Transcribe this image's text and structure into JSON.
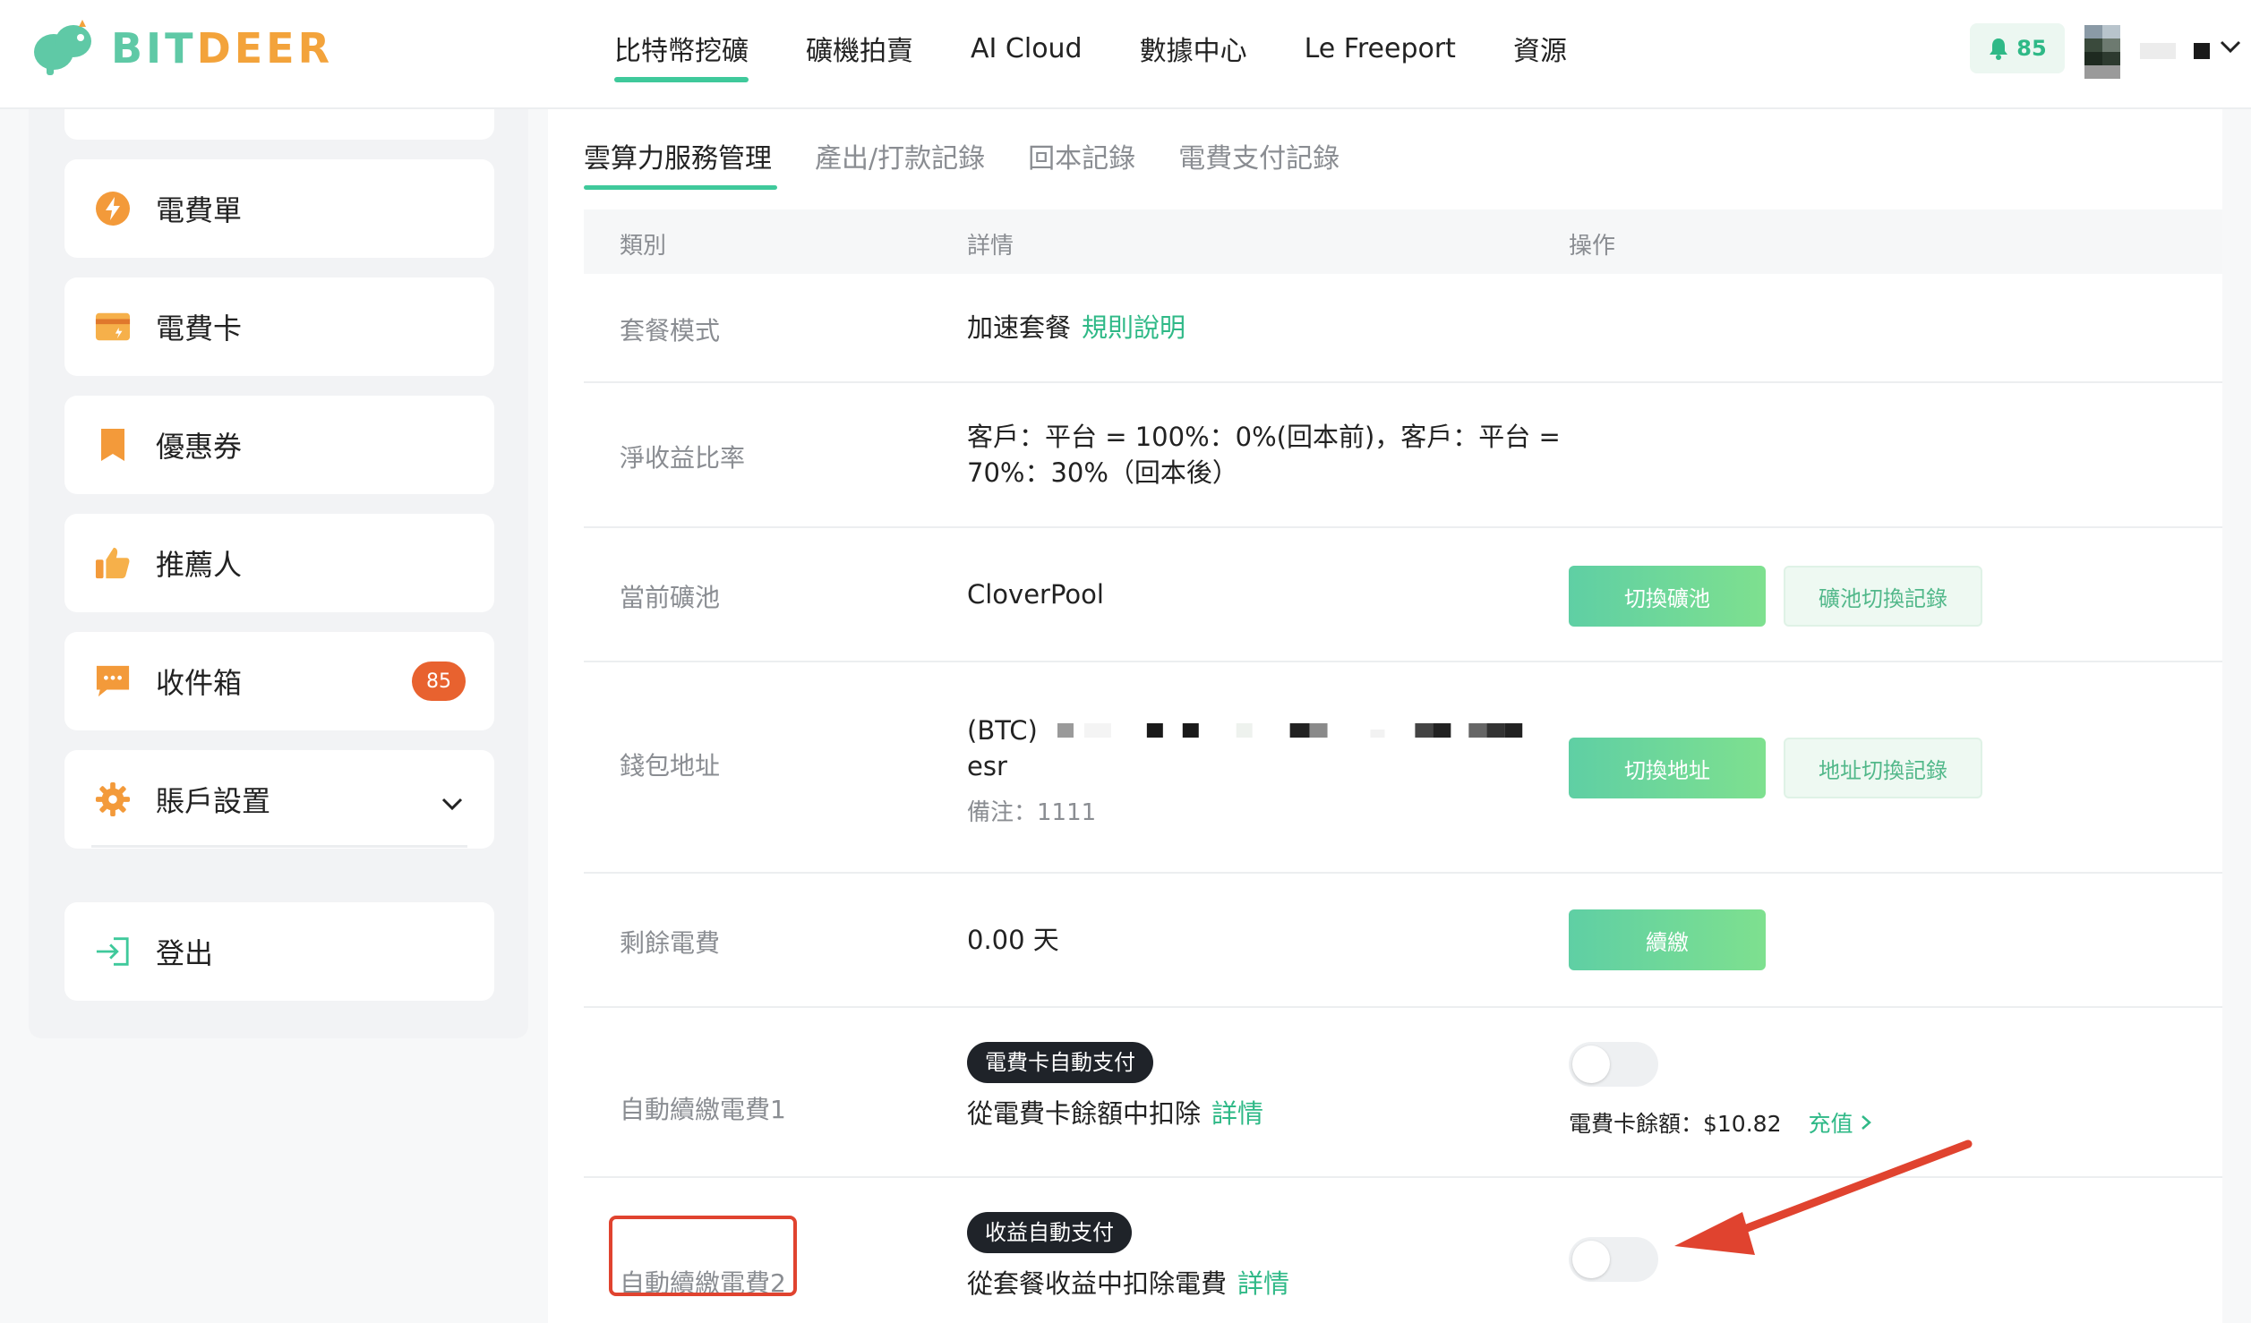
{
  "brand": {
    "name_part1": "BIT",
    "name_part2": "DEER",
    "color_green": "#5fc9a6",
    "color_orange": "#f3a33b"
  },
  "nav": {
    "items": [
      "比特幣挖礦",
      "礦機拍賣",
      "AI Cloud",
      "數據中心",
      "Le Freeport",
      "資源"
    ],
    "active_index": 0
  },
  "header": {
    "notification_count": "85"
  },
  "sidebar": {
    "items": [
      {
        "label": "電費單",
        "icon": "lightning-icon"
      },
      {
        "label": "電費卡",
        "icon": "card-icon"
      },
      {
        "label": "優惠券",
        "icon": "bookmark-icon"
      },
      {
        "label": "推薦人",
        "icon": "thumbs-up-icon"
      },
      {
        "label": "收件箱",
        "icon": "message-icon",
        "badge": "85"
      },
      {
        "label": "賬戶設置",
        "icon": "gear-icon"
      },
      {
        "label": "登出",
        "icon": "logout-icon"
      }
    ]
  },
  "tabs": [
    "雲算力服務管理",
    "產出/打款記錄",
    "回本記錄",
    "電費支付記錄"
  ],
  "table": {
    "headers": {
      "category": "類別",
      "details": "詳情",
      "actions": "操作"
    },
    "rows": {
      "plan": {
        "category": "套餐模式",
        "value": "加速套餐",
        "link": "規則說明"
      },
      "ratio": {
        "category": "淨收益比率",
        "line1": "客戶：平台 = 100%：0%(回本前)，客戶：平台 =",
        "line2": "70%：30%（回本後）"
      },
      "pool": {
        "category": "當前礦池",
        "value": "CloverPool",
        "btn_primary": "切換礦池",
        "btn_secondary": "礦池切換記錄"
      },
      "wallet": {
        "category": "錢包地址",
        "prefix": "(BTC)",
        "suffix": "esr",
        "note": "備注：1111",
        "btn_primary": "切換地址",
        "btn_secondary": "地址切換記錄"
      },
      "fee": {
        "category": "剩餘電費",
        "value": "0.00 天",
        "btn_primary": "續繳"
      },
      "auto1": {
        "category": "自動續繳電費1",
        "tag": "電費卡自動支付",
        "desc": "從電費卡餘額中扣除",
        "link": "詳情",
        "balance_label": "電費卡餘額：$10.82",
        "recharge": "充值"
      },
      "auto2": {
        "category": "自動續繳電費2",
        "tag": "收益自動支付",
        "desc": "從套餐收益中扣除電費",
        "link": "詳情"
      }
    }
  },
  "annotation_color": "#e0432f"
}
